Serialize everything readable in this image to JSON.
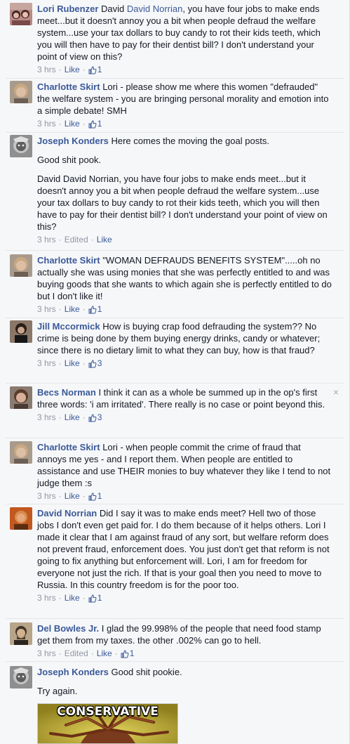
{
  "comments": [
    {
      "author": "Lori Rubenzer",
      "mention": "David Norrian",
      "text_before": "David ",
      "text_after": ", you have four jobs to make ends meet...but it doesn't annoy you a bit when people defraud the welfare system...use your tax dollars to buy candy to rot their kids teeth, which you will then have to pay for their dentist bill? I don't understand your point of view on this?",
      "time": "3 hrs",
      "like_label": "Like",
      "likes": "1"
    },
    {
      "author": "Charlotte Skirt",
      "text": "Lori - please show me where this women \"defrauded\" the welfare system - you are bringing personal morality and emotion into a simple debate! SMH",
      "time": "3 hrs",
      "like_label": "Like",
      "likes": "1"
    },
    {
      "author": "Joseph Konders",
      "text": "Here comes the moving the goal posts.",
      "para2": "Good shit pook.",
      "para3": "David David Norrian, you have four jobs to make ends meet...but it doesn't annoy you a bit when people defraud the welfare system...use your tax dollars to buy candy to rot their kids teeth, which you will then have to pay for their dentist bill? I don't understand your point of view on this?",
      "time": "3 hrs",
      "edited_label": "Edited",
      "like_label": "Like"
    },
    {
      "author": "Charlotte Skirt",
      "text": "\"WOMAN DEFRAUDS BENEFITS SYSTEM\".....oh no actually she was using monies that she was perfectly entitled to and was buying goods that she wants to which again she is perfectly entitled to do but I don't like it!",
      "time": "3 hrs",
      "like_label": "Like",
      "likes": "1"
    },
    {
      "author": "Jill Mccormick",
      "text": "How is buying crap food defrauding the system?? No crime is being done by them buying energy drinks, candy or whatever; since there is no dietary limit to what they can buy, how is that fraud?",
      "time": "3 hrs",
      "like_label": "Like",
      "likes": "3"
    },
    {
      "author": "Becs Norman",
      "text": "I think it can as a whole be summed up in the op's first three words: 'i am irritated'. There really is no case or point beyond this.",
      "time": "3 hrs",
      "like_label": "Like",
      "likes": "3",
      "close_glyph": "×"
    },
    {
      "author": "Charlotte Skirt",
      "text": "Lori - when people commit the crime of fraud that annoys me yes - and I report them. When people are entitled to assistance and use THEIR monies to buy whatever they like I tend to not judge them :s",
      "time": "3 hrs",
      "like_label": "Like",
      "likes": "1"
    },
    {
      "author": "David Norrian",
      "text": "Did I say it was to make ends meet? Hell two of those jobs I don't even get paid for. I do them because of it helps others. Lori I made it clear that I am against fraud of any sort, but welfare reform does not prevent fraud, enforcement does. You just don't get that reform is not going to fix anything but enforcement will. Lori, I am for freedom for everyone not just the rich. If that is your goal then you need to move to Russia. In this country freedom is for the poor too.",
      "time": "3 hrs",
      "like_label": "Like",
      "likes": "1"
    },
    {
      "author": "Del Bowles Jr.",
      "text": "I glad the 99.998% of the people that need food stamp get them from my taxes. the other .002% can go to hell.",
      "time": "3 hrs",
      "edited_label": "Edited",
      "like_label": "Like",
      "likes": "1"
    },
    {
      "author": "Joseph Konders",
      "text": "Good shit pookie.",
      "para2": "Try again.",
      "meme_caption": "CONSERVATIVE"
    }
  ],
  "colors": {
    "link": "#3b5998",
    "meta": "#9197a3",
    "background": "#f6f7f9"
  }
}
